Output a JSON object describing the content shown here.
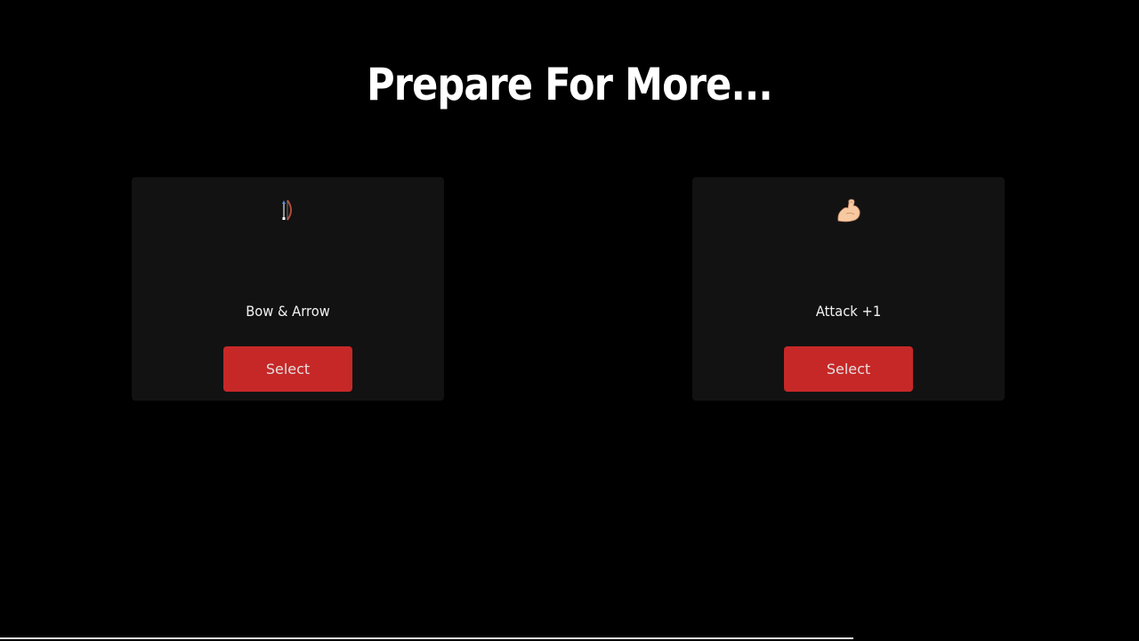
{
  "header": {
    "title": "Prepare For More..."
  },
  "choices": [
    {
      "icon": "bow-and-arrow-icon",
      "name": "Bow & Arrow",
      "button_label": "Select"
    },
    {
      "icon": "flexed-biceps-icon",
      "name": "Attack +1",
      "button_label": "Select"
    }
  ],
  "colors": {
    "background": "#000000",
    "card": "#121212",
    "button": "#c62828",
    "title": "#ffffff"
  }
}
